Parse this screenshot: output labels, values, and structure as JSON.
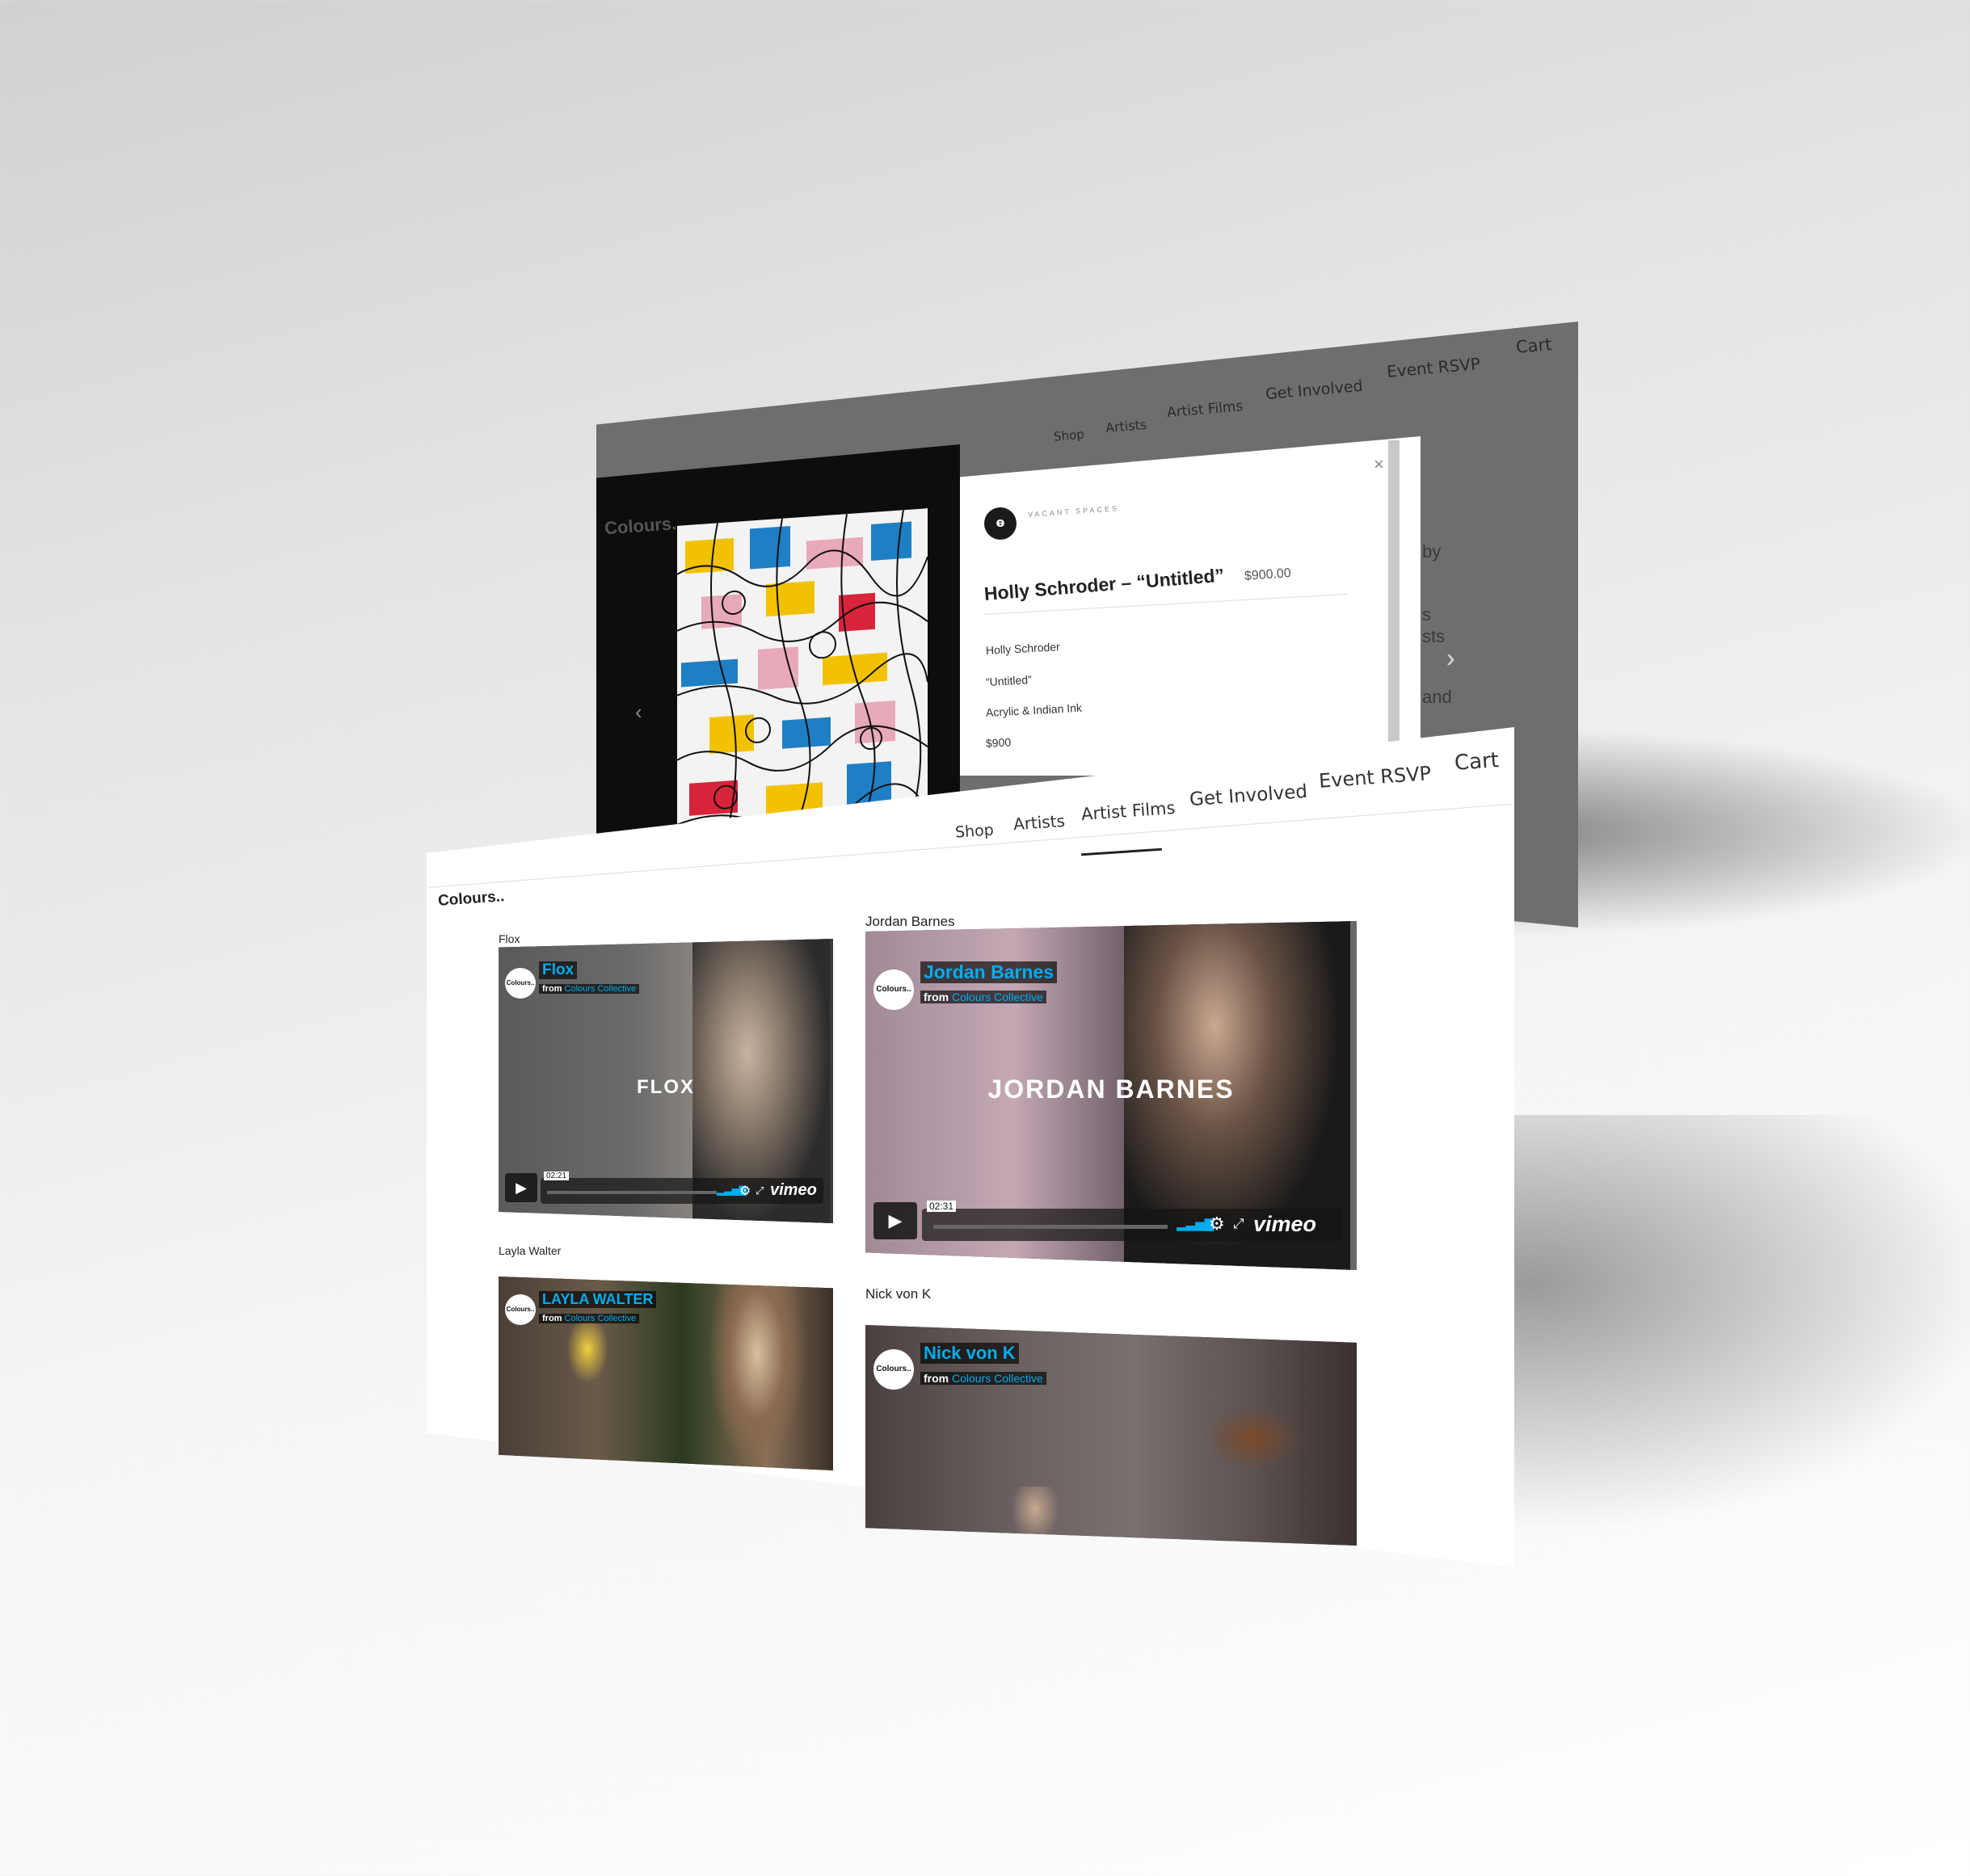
{
  "back_page": {
    "nav": [
      "Shop",
      "Artists",
      "Artist Films",
      "Get Involved",
      "Event RSVP",
      "Cart"
    ],
    "logo": "Colours..",
    "modal": {
      "brand": "VACANT SPACES",
      "close": "×",
      "title": "Holly Schroder – “Untitled”",
      "price": "$900.00",
      "details": [
        "Holly Schroder",
        "“Untitled”",
        "Acrylic & Indian Ink",
        "$900"
      ]
    },
    "partial_text": [
      "by",
      "s",
      "sts",
      "and"
    ],
    "arrow_left": "‹",
    "arrow_right": "›"
  },
  "front_page": {
    "logo": "Colours..",
    "nav": [
      "Shop",
      "Artists",
      "Artist Films",
      "Get Involved",
      "Event RSVP",
      "Cart"
    ],
    "active_nav": "Artist Films",
    "videos": [
      {
        "label": "Flox",
        "overlay_title": "FLOX",
        "vimeo_name": "Flox",
        "from_prefix": "from",
        "from_channel": "Colours Collective",
        "time": "02:21",
        "avatar": "Colours..",
        "logo": "vimeo"
      },
      {
        "label": "Jordan Barnes",
        "overlay_title": "JORDAN BARNES",
        "vimeo_name": "Jordan Barnes",
        "from_prefix": "from",
        "from_channel": "Colours Collective",
        "time": "02:31",
        "avatar": "Colours..",
        "logo": "vimeo"
      },
      {
        "label": "Layla Walter",
        "vimeo_name": "LAYLA WALTER",
        "from_prefix": "from",
        "from_channel": "Colours Collective",
        "avatar": "Colours.."
      },
      {
        "label": "Nick von K",
        "vimeo_name": "Nick von K",
        "from_prefix": "from",
        "from_channel": "Colours Collective",
        "avatar": "Colours.."
      }
    ]
  },
  "colors": {
    "vimeo_blue": "#00adef",
    "back_overlay": "#6e6e6e",
    "dark_panel": "#0d0d0d"
  },
  "icons": [
    "play-icon",
    "volume-icon",
    "settings-icon",
    "fullscreen-icon",
    "close-icon",
    "chevron-left-icon",
    "chevron-right-icon"
  ]
}
